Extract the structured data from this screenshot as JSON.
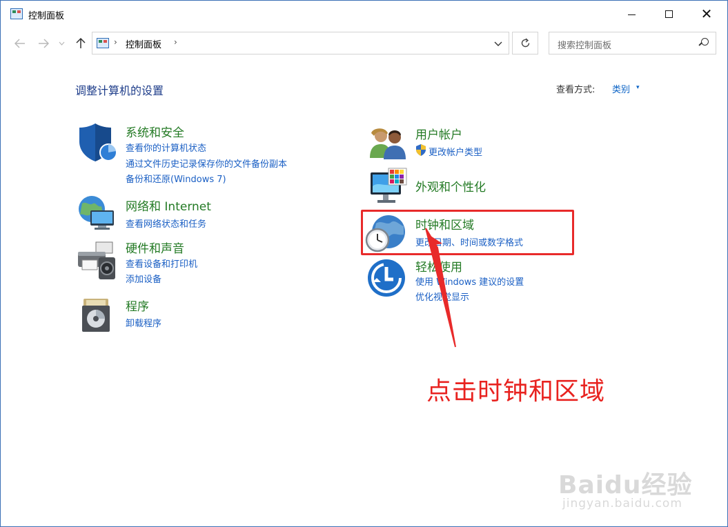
{
  "window": {
    "title": "控制面板",
    "close_glyph": "✕"
  },
  "address_bar": {
    "path": "控制面板",
    "separator": "›",
    "search_placeholder": "搜索控制面板"
  },
  "header": {
    "title": "调整计算机的设置",
    "view_label": "查看方式:",
    "view_value": "类别",
    "view_caret": "▾"
  },
  "categories_left": [
    {
      "title": "系统和安全",
      "links": [
        "查看你的计算机状态",
        "通过文件历史记录保存你的文件备份副本",
        "备份和还原(Windows 7)"
      ],
      "icon": "shield-icon"
    },
    {
      "title": "网络和 Internet",
      "links": [
        "查看网络状态和任务"
      ],
      "icon": "network-globe-icon"
    },
    {
      "title": "硬件和声音",
      "links": [
        "查看设备和打印机",
        "添加设备"
      ],
      "icon": "printer-icon"
    },
    {
      "title": "程序",
      "links": [
        "卸载程序"
      ],
      "icon": "program-disk-icon"
    }
  ],
  "categories_right": [
    {
      "title": "用户帐户",
      "links": [
        "更改帐户类型"
      ],
      "icon": "users-icon"
    },
    {
      "title": "外观和个性化",
      "links": [],
      "icon": "monitor-palette-icon"
    },
    {
      "title": "时钟和区域",
      "links": [
        "更改日期、时间或数字格式"
      ],
      "icon": "clock-globe-icon"
    },
    {
      "title": "轻松使用",
      "links": [
        "使用 Windows 建议的设置",
        "优化视觉显示"
      ],
      "icon": "ease-of-access-icon"
    }
  ],
  "annotation": {
    "text": "点击时钟和区域",
    "color": "#e8221f"
  },
  "watermark": {
    "logo": "Baidu经验",
    "url": "jingyan.baidu.com"
  },
  "colors": {
    "category_title": "#237a24",
    "link": "#1a5fc4",
    "page_title": "#1e3d8a",
    "highlight": "#e82a2a"
  }
}
